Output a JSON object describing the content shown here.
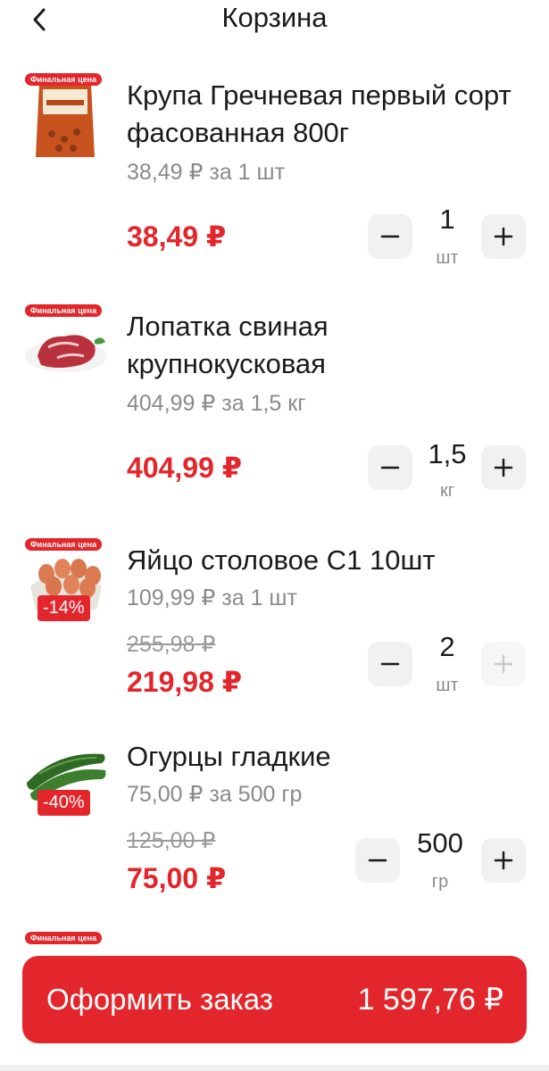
{
  "header": {
    "title": "Корзина",
    "back_icon": "chevron-left-icon"
  },
  "final_price_tag": "Финальная цена",
  "items": [
    {
      "name": "Крупа Гречневая первый сорт фасованная 800г",
      "unit_price": "38,49 ₽ за 1 шт",
      "old_price": "",
      "price": "38,49 ₽",
      "qty": "1",
      "qty_unit": "шт",
      "discount": "",
      "plus_enabled": true
    },
    {
      "name": "Лопатка свиная крупнокусковая",
      "unit_price": "404,99 ₽ за 1,5 кг",
      "old_price": "",
      "price": "404,99 ₽",
      "qty": "1,5",
      "qty_unit": "кг",
      "discount": "",
      "plus_enabled": true
    },
    {
      "name": "Яйцо столовое С1 10шт",
      "unit_price": "109,99 ₽ за 1 шт",
      "old_price": "255,98 ₽",
      "price": "219,98 ₽",
      "qty": "2",
      "qty_unit": "шт",
      "discount": "-14%",
      "plus_enabled": false
    },
    {
      "name": "Огурцы гладкие",
      "unit_price": "75,00 ₽ за 500 гр",
      "old_price": "125,00 ₽",
      "price": "75,00 ₽",
      "qty": "500",
      "qty_unit": "гр",
      "discount": "-40%",
      "plus_enabled": true
    }
  ],
  "order": {
    "label": "Оформить заказ",
    "total": "1 597,76 ₽"
  },
  "colors": {
    "accent": "#e3262c",
    "muted": "#8a8a8a",
    "button_bg": "#f1f1f1"
  }
}
